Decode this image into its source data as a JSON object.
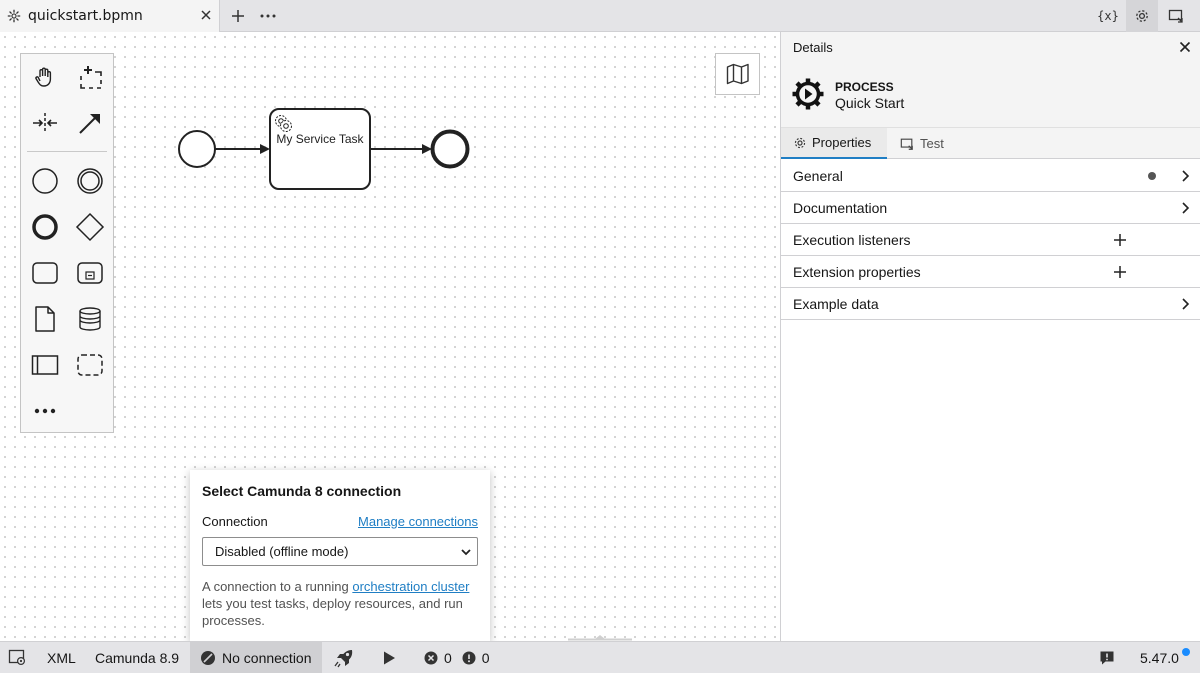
{
  "tabbar": {
    "file_tab": "quickstart.bpmn",
    "vars_label": "{x}"
  },
  "diagram": {
    "task_label": "My Service Task"
  },
  "popup": {
    "title": "Select Camunda 8 connection",
    "connection_label": "Connection",
    "manage_link": "Manage connections",
    "selected_option": "Disabled (offline mode)",
    "desc_before": "A connection to a running ",
    "desc_link": "orchestration cluster",
    "desc_after": " lets you test tasks, deploy resources, and run processes."
  },
  "panel": {
    "header_title": "Details",
    "element_type": "PROCESS",
    "element_name": "Quick Start",
    "tabs": [
      {
        "label": "Properties"
      },
      {
        "label": "Test"
      }
    ],
    "groups": [
      {
        "label": "General"
      },
      {
        "label": "Documentation"
      },
      {
        "label": "Execution listeners"
      },
      {
        "label": "Extension properties"
      },
      {
        "label": "Example data"
      }
    ]
  },
  "status": {
    "xml_label": "XML",
    "engine_label": "Camunda 8.9",
    "connection_label": "No connection",
    "error_count": "0",
    "warning_count": "0",
    "version": "5.47.0"
  },
  "colors": {
    "accent": "#1f7ec4",
    "version_dot": "#1a8cff"
  }
}
